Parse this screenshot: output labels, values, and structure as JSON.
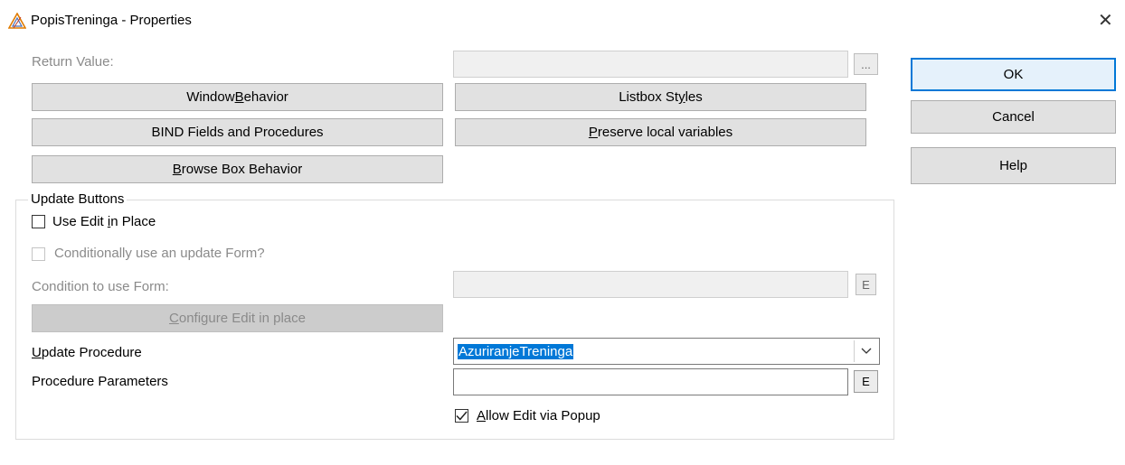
{
  "window": {
    "title": "PopisTreninga - Properties",
    "icon": "clarion-app-icon",
    "close_glyph": "✕"
  },
  "return_value": {
    "label": "Return Value:",
    "value": "",
    "ellipsis": "..."
  },
  "buttons": {
    "window_behavior": {
      "pre": "Window ",
      "key": "B",
      "post": "ehavior"
    },
    "listbox_styles": {
      "pre": "Listbox St",
      "key": "y",
      "post": "les"
    },
    "bind_fields": "BIND Fields and Procedures",
    "preserve_vars": {
      "pre": "",
      "key": "P",
      "post": "reserve local variables"
    },
    "browse_box": {
      "pre": "",
      "key": "B",
      "post": "rowse Box Behavior"
    },
    "configure_edit": {
      "pre": "",
      "key": "C",
      "post": "onfigure Edit in place"
    }
  },
  "dialog_buttons": {
    "ok": "OK",
    "cancel": "Cancel",
    "help": "Help"
  },
  "update_group": {
    "title": "Update Buttons",
    "use_edit_in_place": {
      "pre": "Use Edit ",
      "key": "i",
      "post": "n Place",
      "checked": false
    },
    "conditional_form": {
      "label": "Conditionally use an update Form?",
      "checked": false
    },
    "condition_label": "Condition to use Form:",
    "condition_value": "",
    "e_button": "E",
    "update_procedure": {
      "pre": "",
      "key": "U",
      "post": "pdate Procedure",
      "value": "AzuriranjeTreninga"
    },
    "procedure_parameters": {
      "label": "Procedure Parameters",
      "value": ""
    },
    "allow_edit_popup": {
      "pre": "",
      "key": "A",
      "post": "llow Edit via Popup",
      "checked": true
    }
  },
  "icons": {
    "dropdown": "chevron-down-icon",
    "check": "checkmark-icon"
  }
}
